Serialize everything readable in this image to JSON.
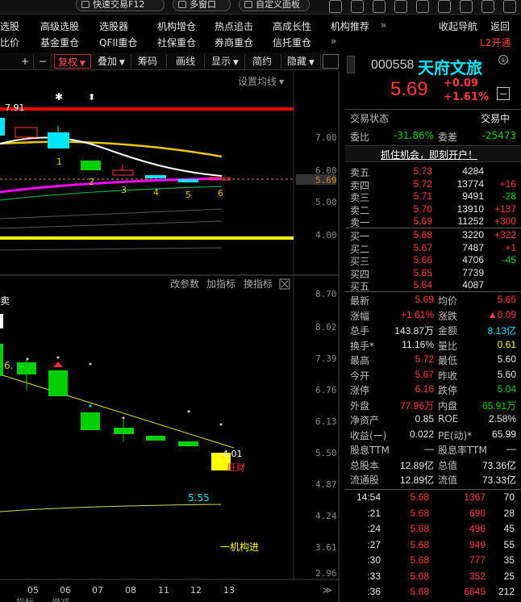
{
  "topbar": {
    "quick_trade": "快速交易F12",
    "multi_window": "多窗口",
    "custom_board": "自定义面板"
  },
  "menu_row1": [
    "选股",
    "高级选股",
    "选股器",
    "机构增仓",
    "热点追击",
    "高成长性",
    "机构推荐",
    "收起导航",
    "返回"
  ],
  "menu_row2": [
    "比价",
    "基金重仓",
    "QFII重仓",
    "社保重仓",
    "券商重仓",
    "信托重仓",
    "L2开通"
  ],
  "more_glyph": "»",
  "toolbar": {
    "plus": "+",
    "minus": "−",
    "fuquan": "复权",
    "diejia": "叠加",
    "chouma": "筹码",
    "huaxian": "画线",
    "xianshi": "显示",
    "jianyue": "简约",
    "yincang": "隐藏"
  },
  "chart": {
    "set_ma": "设置均线",
    "high_label": "7.91",
    "price_axis": [
      "7.00",
      "6.00",
      "5.69",
      "5.00",
      "4.00"
    ],
    "sub_axis": [
      "8.70",
      "8.02",
      "7.39",
      "6.76",
      "6.13",
      "5.50",
      "4.87",
      "4.24",
      "3.61",
      "2.96"
    ],
    "candle_numbers": [
      "1",
      "2",
      "3",
      "4",
      "5",
      "6"
    ],
    "sub_tools": [
      "改参数",
      "加指标",
      "换指标"
    ],
    "sub_value_left": "6.",
    "sub_value_mid": "5.55",
    "sub_value_right": "4.01",
    "sub_mark": "旺财",
    "sub_bottom_label": "一机构进",
    "sub_label_left": "卖",
    "x_axis": [
      "05",
      "06",
      "07",
      "08",
      "11",
      "12",
      "13"
    ],
    "tabs": [
      "指标",
      "增减"
    ]
  },
  "quote": {
    "code": "000558",
    "name": "天府文旅",
    "price": "5.69",
    "change": "+0.09",
    "change_pct": "+1.61%",
    "status_label": "交易状态",
    "status_value": "交易中",
    "weibi_label": "委比",
    "weibi": "-31.86%",
    "weicha_label": "委差",
    "weicha": "-25473",
    "promo": "抓住机会，即刻开户！",
    "asks": [
      {
        "label": "卖五",
        "price": "5.73",
        "vol": "4284",
        "chg": ""
      },
      {
        "label": "卖四",
        "price": "5.72",
        "vol": "13774",
        "chg": "+16"
      },
      {
        "label": "卖三",
        "price": "5.71",
        "vol": "9491",
        "chg": "-28"
      },
      {
        "label": "卖二",
        "price": "5.70",
        "vol": "13910",
        "chg": "+137"
      },
      {
        "label": "卖一",
        "price": "5.69",
        "vol": "11252",
        "chg": "+300"
      }
    ],
    "bids": [
      {
        "label": "买一",
        "price": "5.68",
        "vol": "3220",
        "chg": "+322"
      },
      {
        "label": "买二",
        "price": "5.67",
        "vol": "7487",
        "chg": "+1"
      },
      {
        "label": "买三",
        "price": "5.66",
        "vol": "4706",
        "chg": "-45"
      },
      {
        "label": "买四",
        "price": "5.65",
        "vol": "7739",
        "chg": ""
      },
      {
        "label": "买五",
        "price": "5.64",
        "vol": "4087",
        "chg": ""
      }
    ],
    "stats": [
      {
        "l1": "最新",
        "v1": "5.69",
        "c1": "red",
        "l2": "均价",
        "v2": "5.65",
        "c2": "red"
      },
      {
        "l1": "涨幅",
        "v1": "+1.61%",
        "c1": "red",
        "l2": "涨跌",
        "v2": "▲0.09",
        "c2": "red"
      },
      {
        "l1": "总手",
        "v1": "143.87万",
        "c1": "wht",
        "l2": "金额",
        "v2": "8.13亿",
        "c2": "cyan"
      },
      {
        "l1": "换手*",
        "v1": "11.16%",
        "c1": "wht",
        "l2": "量比",
        "v2": "0.61",
        "c2": "yel"
      },
      {
        "l1": "最高",
        "v1": "5.72",
        "c1": "red",
        "l2": "最低",
        "v2": "5.60",
        "c2": "wht"
      },
      {
        "l1": "今开",
        "v1": "5.67",
        "c1": "red",
        "l2": "昨收",
        "v2": "5.60",
        "c2": "wht"
      },
      {
        "l1": "涨停",
        "v1": "6.16",
        "c1": "red",
        "l2": "跌停",
        "v2": "5.04",
        "c2": "grn"
      },
      {
        "l1": "外盘",
        "v1": "77.96万",
        "c1": "red",
        "l2": "内盘",
        "v2": "65.91万",
        "c2": "grn"
      },
      {
        "l1": "净资产",
        "v1": "0.85",
        "c1": "wht",
        "l2": "ROE",
        "v2": "2.58%",
        "c2": "wht"
      },
      {
        "l1": "收益(一)",
        "v1": "0.022",
        "c1": "wht",
        "l2": "PE(动)*",
        "v2": "65.99",
        "c2": "wht"
      },
      {
        "l1": "股息TTM",
        "v1": "—",
        "c1": "wht",
        "l2": "股息率TTM",
        "v2": "—",
        "c2": "wht"
      },
      {
        "l1": "总股本",
        "v1": "12.89亿",
        "c1": "wht",
        "l2": "总值",
        "v2": "73.36亿",
        "c2": "wht"
      },
      {
        "l1": "流通股",
        "v1": "12.89亿",
        "c1": "wht",
        "l2": "流值",
        "v2": "73.33亿",
        "c2": "wht"
      }
    ],
    "ticks": [
      {
        "time": "14:54",
        "price": "5.68",
        "vol": "1367",
        "n": "70"
      },
      {
        "time": ":21",
        "price": "5.68",
        "vol": "690",
        "n": "28"
      },
      {
        "time": ":24",
        "price": "5.68",
        "vol": "496",
        "n": "45"
      },
      {
        "time": ":27",
        "price": "5.68",
        "vol": "949",
        "n": "55"
      },
      {
        "time": ":30",
        "price": "5.68",
        "vol": "777",
        "n": "35"
      },
      {
        "time": ":33",
        "price": "5.68",
        "vol": "352",
        "n": "25"
      },
      {
        "time": ":36",
        "price": "5.68",
        "vol": "6645",
        "n": "212"
      }
    ]
  },
  "colors": {
    "up": "#ff3b3b",
    "down": "#00d000",
    "accent": "#00e5ff",
    "yellow": "#ffff00",
    "bg": "#000000"
  }
}
